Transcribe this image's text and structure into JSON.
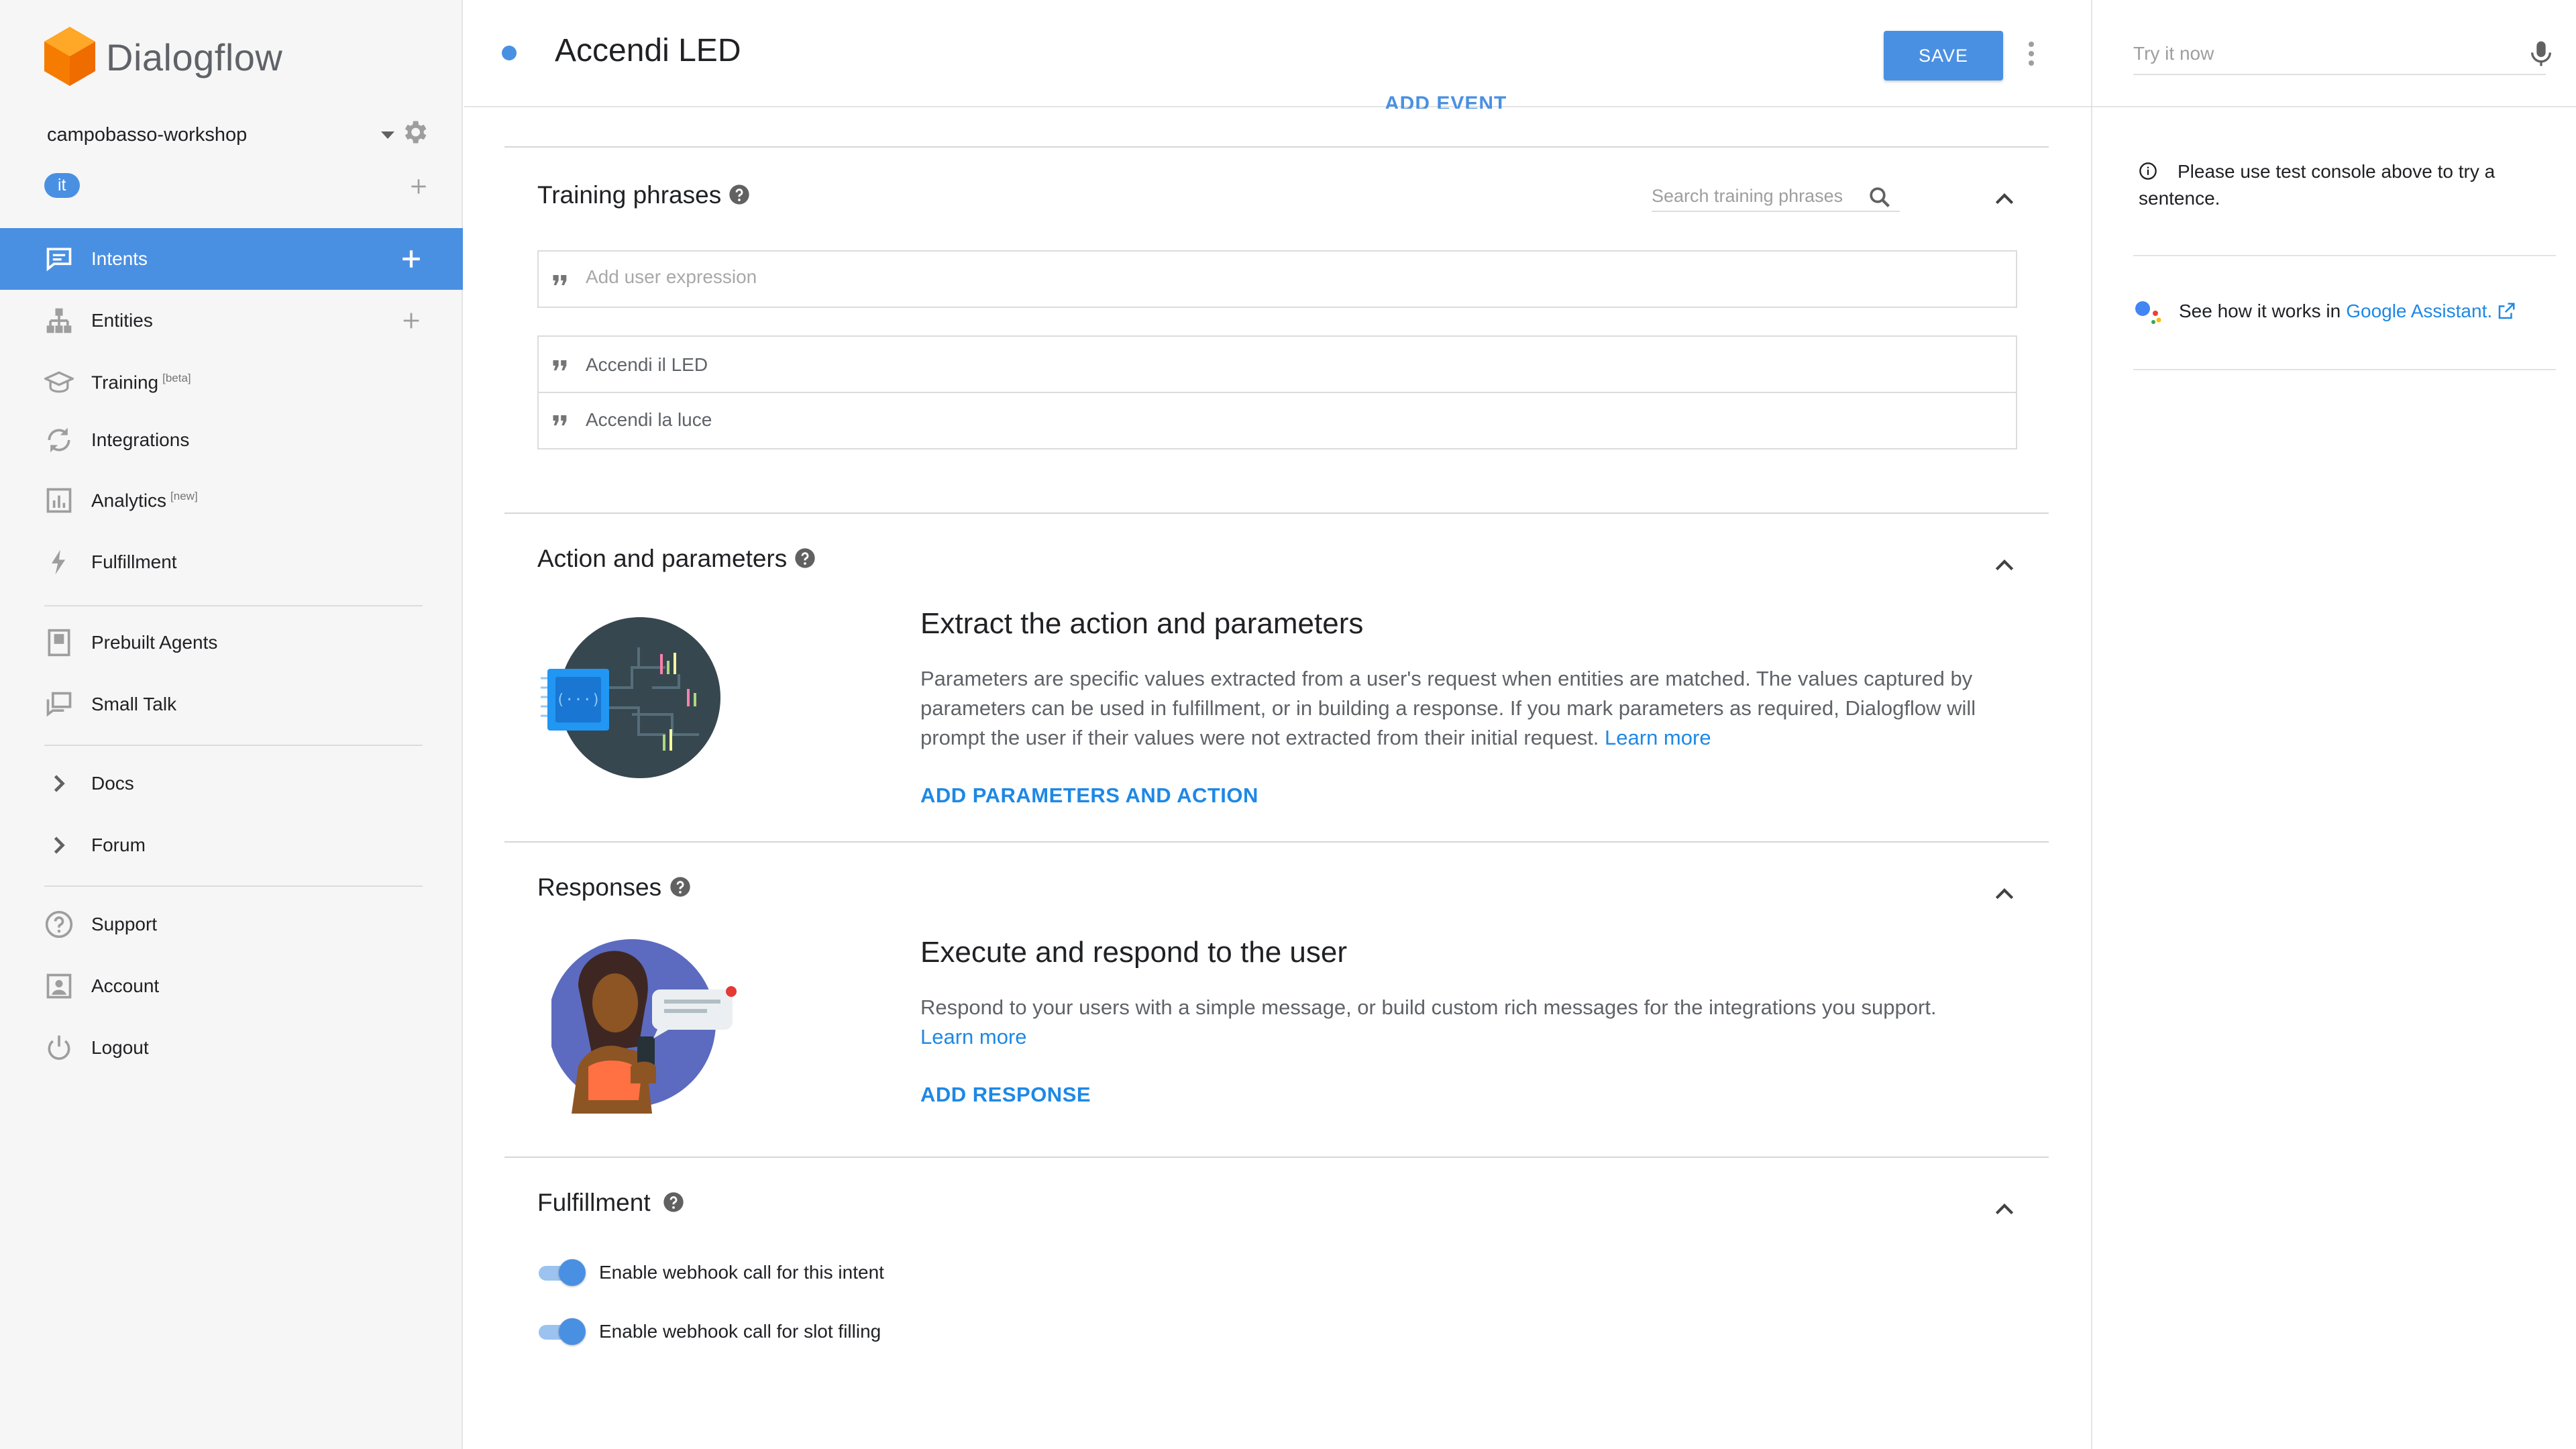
{
  "app": {
    "brand_name": "Dialogflow",
    "agent_name": "campobasso-workshop",
    "language_chip": "it"
  },
  "sidebar": {
    "items": [
      {
        "label": "Intents",
        "icon": "chat-bubble-icon",
        "active": true,
        "has_add": true
      },
      {
        "label": "Entities",
        "icon": "hierarchy-icon",
        "has_add": true
      },
      {
        "label": "Training",
        "sup": "[beta]",
        "icon": "graduation-cap-icon"
      },
      {
        "label": "Integrations",
        "icon": "sync-icon"
      },
      {
        "label": "Analytics",
        "sup": "[new]",
        "icon": "bar-chart-icon"
      },
      {
        "label": "Fulfillment",
        "icon": "lightning-icon"
      },
      {
        "label": "Prebuilt Agents",
        "icon": "book-icon"
      },
      {
        "label": "Small Talk",
        "icon": "chat-windows-icon"
      },
      {
        "label": "Docs",
        "icon": "chevron-right-icon"
      },
      {
        "label": "Forum",
        "icon": "chevron-right-icon"
      },
      {
        "label": "Support",
        "icon": "help-circle-icon"
      },
      {
        "label": "Account",
        "icon": "account-box-icon"
      },
      {
        "label": "Logout",
        "icon": "power-icon"
      }
    ]
  },
  "header": {
    "intent_title": "Accendi LED",
    "save_label": "SAVE",
    "cut_off_link": "ADD EVENT"
  },
  "training_phrases": {
    "title": "Training phrases",
    "search_placeholder": "Search training phrases",
    "add_placeholder": "Add user expression",
    "phrases": [
      "Accendi il LED",
      "Accendi la luce"
    ]
  },
  "action_parameters": {
    "title": "Action and parameters",
    "heading": "Extract the action and parameters",
    "body": "Parameters are specific values extracted from a user's request when entities are matched. The values captured by parameters can be used in fulfillment, or in building a response. If you mark parameters as required, Dialogflow will prompt the user if their values were not extracted from their initial request.",
    "learn_more": "Learn more",
    "action_link": "ADD PARAMETERS AND ACTION"
  },
  "responses": {
    "title": "Responses",
    "heading": "Execute and respond to the user",
    "body": "Respond to your users with a simple message, or build custom rich messages for the integrations you support.",
    "learn_more": "Learn more",
    "action_link": "ADD RESPONSE"
  },
  "fulfillment": {
    "title": "Fulfillment",
    "toggles": [
      {
        "label": "Enable webhook call for this intent",
        "on": true
      },
      {
        "label": "Enable webhook call for slot filling",
        "on": true
      }
    ]
  },
  "right_panel": {
    "try_placeholder": "Try it now",
    "info_text": "Please use test console above to try a sentence.",
    "ga_prefix": "See how it works in",
    "ga_link": "Google Assistant."
  },
  "colors": {
    "accent": "#4a90e2",
    "link": "#1e88e5",
    "logo_orange": "#f57c00"
  }
}
